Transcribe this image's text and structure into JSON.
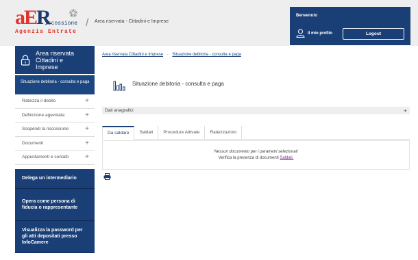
{
  "header": {
    "logo_big_a": "a",
    "logo_big_e": "E",
    "logo_big_r": "R",
    "logo_riscossione": "iscossione",
    "logo_agenzia": "Agenzia Entrate",
    "title": "Area riservata - Cittadini e Imprese",
    "welcome": "Benvenuto",
    "profile_label": "Il mio profilo",
    "logout_label": "Logout"
  },
  "sidebar": {
    "head_title": "Area riservata Cittadini e Imprese",
    "active_item": "Situazione debitoria - consulta e paga",
    "items": [
      {
        "label": "Rateizza il debito",
        "icon": "+"
      },
      {
        "label": "Definizione agevolata",
        "icon": "+"
      },
      {
        "label": "Sospendi la riscossione",
        "icon": "+"
      },
      {
        "label": "Documenti",
        "icon": "+"
      },
      {
        "label": "Appuntamenti e contatti",
        "icon": "+"
      }
    ],
    "blocks": [
      {
        "label": "Delega un intermediario"
      },
      {
        "label": "Opera come persona di fiducia o rappresentante"
      },
      {
        "label": "Visualizza la password per gli atti depositati presso InfoCamere"
      }
    ]
  },
  "breadcrumb": {
    "first": "Area riservata Cittadini e Imprese",
    "separator": "-",
    "second": "Situazione debitoria - consulta e paga"
  },
  "page": {
    "title": "Situazione debitoria - consulta e paga",
    "accordion_label": "Dati anagrafici",
    "accordion_icon": "+"
  },
  "tabs": [
    {
      "label": "Da saldare",
      "active": true
    },
    {
      "label": "Saldati",
      "active": false
    },
    {
      "label": "Procedure Attivate",
      "active": false
    },
    {
      "label": "Rateizzazioni",
      "active": false
    }
  ],
  "result": {
    "line1": "Nessun documento per i parametri selezionati",
    "line2_prefix": "Verifica la presenza di documenti",
    "line2_link": "Saldati."
  },
  "colors": {
    "brand_blue": "#1a3f77",
    "brand_red": "#e2332a",
    "link_visited": "#7a2c8c"
  },
  "icons": {
    "lock": "lock-icon",
    "user": "user-icon",
    "chart": "bar-chart-icon",
    "print": "printer-icon"
  }
}
